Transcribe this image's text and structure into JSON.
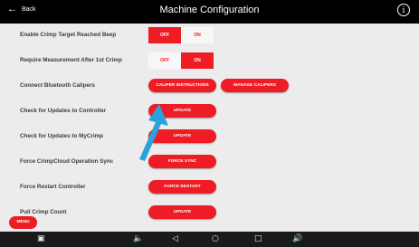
{
  "header": {
    "back_label": "Back",
    "title": "Machine Configuration",
    "info_icon": "info-icon"
  },
  "rows": [
    {
      "label": "Enable Crimp Target Reached Beep",
      "off_label": "OFF",
      "on_label": "ON",
      "selected": "OFF"
    },
    {
      "label": "Require Measurement After 1st Crimp",
      "off_label": "OFF",
      "on_label": "ON",
      "selected": "ON"
    },
    {
      "label": "Connect Bluetooth Calipers",
      "buttons": [
        "CALIPER INSTRUCTIONS",
        "MANAGE CALIPERS"
      ]
    },
    {
      "label": "Check for Updates to Controller",
      "button": "UPDATE"
    },
    {
      "label": "Check for Updates to MyCrimp",
      "button": "UPDATE"
    },
    {
      "label": "Force CrimpCloud Operation Sync",
      "button": "FORCE SYNC"
    },
    {
      "label": "Force Restart Controller",
      "button": "FORCE RESTART"
    },
    {
      "label": "Pull Crimp Count",
      "button": "UPDATE"
    }
  ],
  "menu_label": "MENU",
  "colors": {
    "accent": "#ee1c24",
    "annotation_arrow": "#2aa3dc",
    "header_bg": "#000000",
    "content_bg": "#ececec"
  },
  "nav_icons": [
    "screenshot-icon",
    "volume-down-icon",
    "back-triangle-icon",
    "home-circle-icon",
    "recents-square-icon",
    "volume-up-icon"
  ]
}
